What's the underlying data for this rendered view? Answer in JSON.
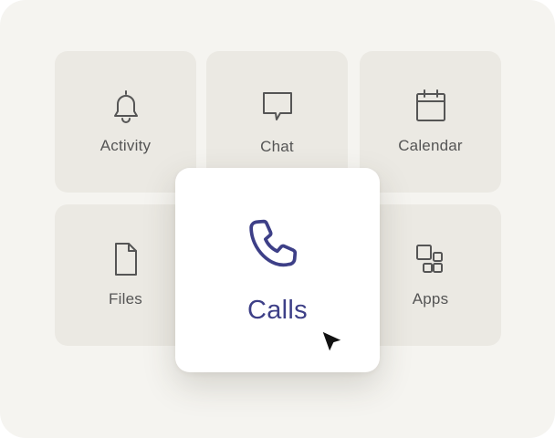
{
  "tiles": {
    "activity": {
      "label": "Activity",
      "icon": "bell-icon"
    },
    "chat": {
      "label": "Chat",
      "icon": "chat-icon"
    },
    "calendar": {
      "label": "Calendar",
      "icon": "calendar-icon"
    },
    "files": {
      "label": "Files",
      "icon": "file-icon"
    },
    "apps": {
      "label": "Apps",
      "icon": "apps-grid-icon"
    }
  },
  "selected": {
    "label": "Calls",
    "icon": "phone-icon"
  },
  "cursor": {
    "icon": "mouse-pointer-icon"
  },
  "colors": {
    "panel_bg": "#f5f4f0",
    "tile_bg": "#ebe9e3",
    "tile_icon": "#555555",
    "accent": "#3d3f87"
  }
}
